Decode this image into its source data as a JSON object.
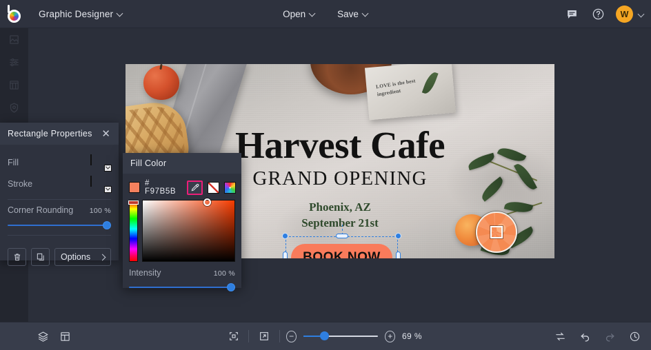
{
  "topbar": {
    "logo_name": "brand-logo",
    "document_title": "Graphic Designer",
    "open_label": "Open",
    "save_label": "Save",
    "comment_icon": "comment-icon",
    "help_icon": "help-icon",
    "avatar_initial": "W"
  },
  "left_rail": {
    "items": [
      {
        "icon": "image-icon",
        "label": "Image"
      },
      {
        "icon": "adjust-icon",
        "label": "Adjust"
      },
      {
        "icon": "effects-icon",
        "label": "Effects"
      },
      {
        "icon": "badge-icon",
        "label": "Badge"
      }
    ]
  },
  "properties_panel": {
    "title": "Rectangle Properties",
    "close_icon": "close-icon",
    "fill_label": "Fill",
    "fill_color": "#F4815E",
    "stroke_label": "Stroke",
    "stroke_color": "none",
    "corner_rounding_label": "Corner Rounding",
    "corner_rounding_value": "100 %",
    "delete_icon": "trash-icon",
    "duplicate_icon": "duplicate-icon",
    "options_label": "Options",
    "options_caret": "chevron-right-icon"
  },
  "fill_color_popup": {
    "title": "Fill Color",
    "hex_value": "# F97B5B",
    "swatch_color": "#F4815E",
    "eyedropper_icon": "eyedropper-icon",
    "eyedropper_active": true,
    "eyedropper_highlight_color": "#EC1E79",
    "no_color_swatch": "no-color-icon",
    "color_wheel_swatch": "color-wheel-icon",
    "intensity_label": "Intensity",
    "intensity_value": "100 %"
  },
  "canvas": {
    "poster": {
      "title": "Harvest Cafe",
      "subtitle": "GRAND OPENING",
      "city": "Phoenix, AZ",
      "date": "September 21st",
      "button_label": "BOOK NOW",
      "button_color": "#F97B5B",
      "napkin_text": "LOVE is the best ingredient"
    },
    "selection": {
      "name": "rectangle-selection",
      "handle_color": "#2F7FE0"
    },
    "loupe": {
      "name": "eyedropper-loupe"
    }
  },
  "bottombar": {
    "layers_icon": "layers-icon",
    "pages_icon": "pages-icon",
    "fit_icon": "fit-to-screen-icon",
    "fullscreen_icon": "expand-icon",
    "zoom_out_icon": "minus-icon",
    "zoom_in_icon": "plus-icon",
    "zoom_value": "69 %",
    "swap_icon": "swap-icon",
    "undo_icon": "undo-icon",
    "redo_icon": "redo-icon",
    "history_icon": "history-clock-icon"
  }
}
